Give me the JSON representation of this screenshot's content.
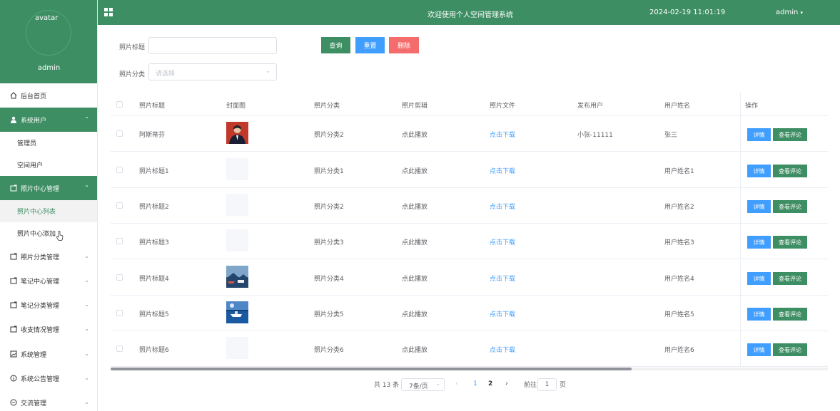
{
  "sidebar": {
    "avatar_alt": "avatar",
    "username": "admin",
    "items": [
      {
        "label": "后台首页",
        "icon": "home-icon"
      },
      {
        "label": "系统用户",
        "icon": "user-icon"
      },
      {
        "label": "照片中心管理",
        "icon": "folder-icon"
      },
      {
        "label": "照片分类管理",
        "icon": "folder-icon"
      },
      {
        "label": "笔记中心管理",
        "icon": "folder-icon"
      },
      {
        "label": "笔记分类管理",
        "icon": "folder-icon"
      },
      {
        "label": "收支情况管理",
        "icon": "folder-icon"
      },
      {
        "label": "系统管理",
        "icon": "picture-icon"
      },
      {
        "label": "系统公告管理",
        "icon": "info-icon"
      },
      {
        "label": "交流管理",
        "icon": "chat-icon"
      }
    ],
    "sub_users": [
      "管理员",
      "空间用户"
    ],
    "sub_photo": [
      "照片中心列表",
      "照片中心添加"
    ]
  },
  "header": {
    "title": "欢迎使用个人空间管理系统",
    "time": "2024-02-19 11:01:19",
    "user": "admin"
  },
  "filters": {
    "title_label": "照片标题",
    "title_value": "",
    "category_label": "照片分类",
    "category_placeholder": "请选择",
    "search_btn": "查询",
    "reset_btn": "重置",
    "delete_btn": "删除"
  },
  "table": {
    "headers": [
      "照片标题",
      "封面图",
      "照片分类",
      "照片剪辑",
      "照片文件",
      "发布用户",
      "用户姓名",
      "操作"
    ],
    "rows": [
      {
        "title": "阿斯蒂芬",
        "cover": "portrait",
        "category": "照片分类2",
        "clip": "点此播放",
        "file": "点击下载",
        "publisher": "小张-11111",
        "name": "张三"
      },
      {
        "title": "照片标题1",
        "cover": "empty",
        "category": "照片分类1",
        "clip": "点此播放",
        "file": "点击下载",
        "publisher": "",
        "name": "用户姓名1"
      },
      {
        "title": "照片标题2",
        "cover": "empty",
        "category": "照片分类2",
        "clip": "点此播放",
        "file": "点击下载",
        "publisher": "",
        "name": "用户姓名2"
      },
      {
        "title": "照片标题3",
        "cover": "empty",
        "category": "照片分类3",
        "clip": "点此播放",
        "file": "点击下载",
        "publisher": "",
        "name": "用户姓名3"
      },
      {
        "title": "照片标题4",
        "cover": "landscape",
        "category": "照片分类4",
        "clip": "点此播放",
        "file": "点击下载",
        "publisher": "",
        "name": "用户姓名4"
      },
      {
        "title": "照片标题5",
        "cover": "ocean",
        "category": "照片分类5",
        "clip": "点此播放",
        "file": "点击下载",
        "publisher": "",
        "name": "用户姓名5"
      },
      {
        "title": "照片标题6",
        "cover": "empty",
        "category": "照片分类6",
        "clip": "点此播放",
        "file": "点击下载",
        "publisher": "",
        "name": "用户姓名6"
      }
    ],
    "detail_btn": "详情",
    "comment_btn": "查看评论"
  },
  "pagination": {
    "total": "共 13 条",
    "page_size": "7条/页",
    "pages": [
      "1",
      "2"
    ],
    "current_page": "1",
    "goto_label": "前往",
    "goto_value": "1",
    "page_unit": "页"
  },
  "colors": {
    "primary": "#3e8e63",
    "blue": "#409eff",
    "danger": "#f56c6c"
  }
}
